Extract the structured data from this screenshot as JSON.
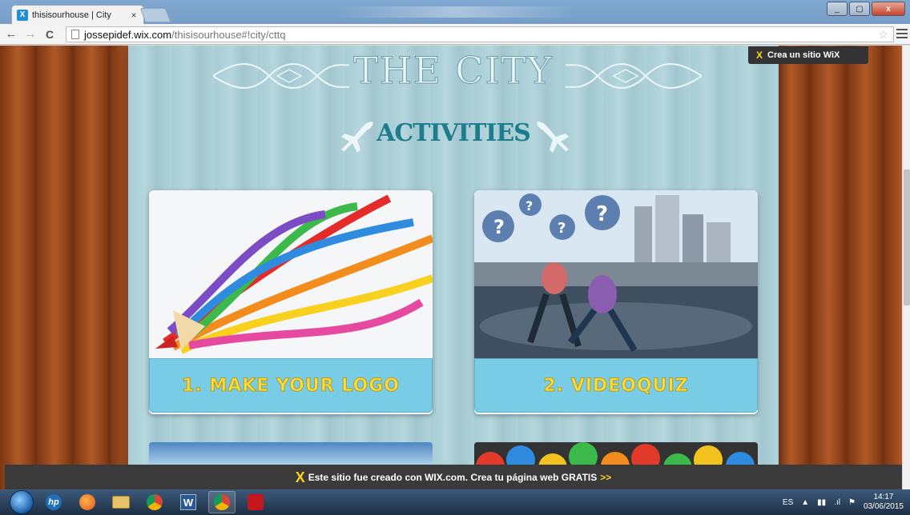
{
  "browser": {
    "tab_title": "thisisourhouse | City",
    "tab_close": "×",
    "url_host": "jossepidef.wix.com",
    "url_path": "/thisisourhouse#!city/cttq",
    "back_icon": "←",
    "forward_icon": "→",
    "reload_icon": "C",
    "star_icon": "☆"
  },
  "window_controls": {
    "minimize": "_",
    "maximize": "▢",
    "close": "x"
  },
  "page": {
    "title": "THE CITY",
    "subtitle": "ACTIVITIES",
    "cards": [
      {
        "label": "1. MAKE YOUR LOGO"
      },
      {
        "label": "2. VIDEOQUIZ"
      }
    ]
  },
  "wix": {
    "promo_label": "Crea un sitio WiX",
    "banner_text": "Este sitio fue creado con WIX.com. Crea tu página web GRATIS",
    "banner_arrows": ">>",
    "logo_glyph": "X"
  },
  "taskbar": {
    "language": "ES",
    "time": "14:17",
    "date": "03/06/2015",
    "hp_label": "hp",
    "word_label": "W"
  },
  "colors": {
    "accent_teal": "#1d7d8c",
    "card_label_bg": "#79cce6",
    "card_label_text": "#f6de4a",
    "wix_yellow": "#ffd21e"
  }
}
